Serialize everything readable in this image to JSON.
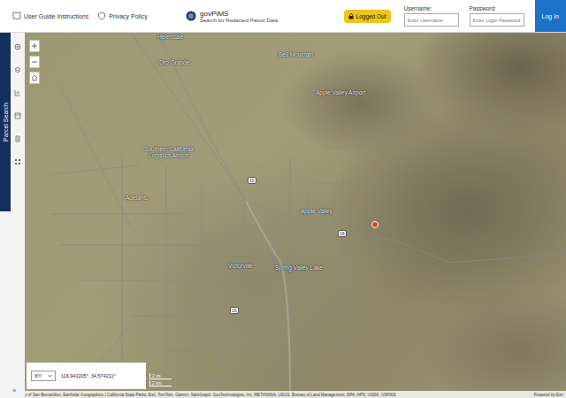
{
  "header": {
    "links": [
      {
        "label": "User Guide Instructions"
      },
      {
        "label": "Privacy Policy"
      }
    ],
    "app": {
      "title": "govPIMS",
      "subtitle": "Search for Redacted Parcel Data"
    },
    "status": {
      "label": "Logged Out"
    },
    "login": {
      "username_label": "Username:",
      "username_placeholder": "Enter Username",
      "password_label": "Password:",
      "password_placeholder": "Enter Login Password",
      "button": "Log In"
    }
  },
  "side_tab": {
    "label": "Parcel Search"
  },
  "sidebar_expand": "»",
  "map": {
    "labels": [
      {
        "text": "Helendale"
      },
      {
        "text": "Oro Grande"
      },
      {
        "text": "Bell Mountain"
      },
      {
        "text": "Apple Valley Airport"
      },
      {
        "text": "Southern California Logistics Airport"
      },
      {
        "text": "Adelanto"
      },
      {
        "text": "Apple Valley"
      },
      {
        "text": "Victorville"
      },
      {
        "text": "Spring Valley Lake"
      }
    ],
    "shields": [
      {
        "text": "15"
      },
      {
        "text": "18"
      },
      {
        "text": "15"
      }
    ],
    "marker": {
      "color": "#d9442b"
    }
  },
  "coordinates": {
    "mode": "XY",
    "value": "116.941205°, 34.574211°"
  },
  "scale": {
    "miles": "2 mi",
    "km": "2 km"
  },
  "attribution": "y of San Bernardino, Earthstar Geographics | California State Parks, Esri, TomTom, Garmin, SafeGraph, GeoTechnologies, Inc, METI/NASA, USGS, Bureau of Land Management, EPA, NPS, USDA, USFWS",
  "powered_by": "Powered by Esri"
}
